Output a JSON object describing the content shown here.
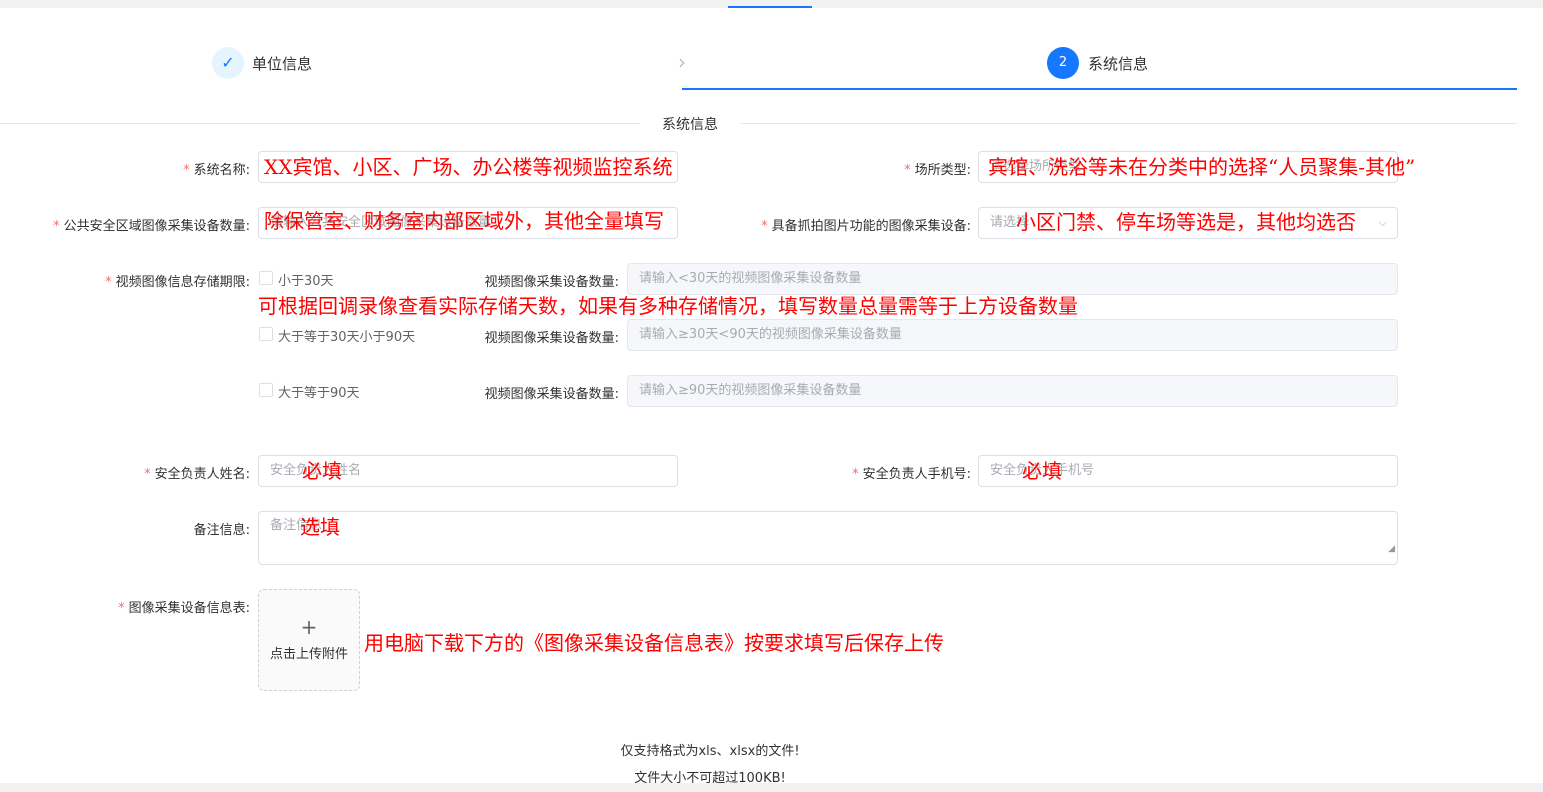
{
  "steps": {
    "step1": {
      "icon": "✓",
      "title": "单位信息"
    },
    "step2": {
      "number": "2",
      "title": "系统信息"
    }
  },
  "section_title": "系统信息",
  "fields": {
    "system_name": {
      "label": "系统名称:",
      "required": "*"
    },
    "site_type": {
      "label": "场所类型:",
      "required": "*",
      "placeholder": "请选择场所类型"
    },
    "public_devices": {
      "label": "公共安全区域图像采集设备数量:",
      "required": "*",
      "placeholder": "请输入公共安全区域图像采集设备数量"
    },
    "snapshot_devices": {
      "label": "具备抓拍图片功能的图像采集设备:",
      "required": "*",
      "placeholder": "请选择"
    },
    "storage_period": {
      "label": "视频图像信息存储期限:",
      "required": "*",
      "count_label": "视频图像采集设备数量:",
      "options": [
        {
          "text": "小于30天",
          "placeholder": "请输入<30天的视频图像采集设备数量"
        },
        {
          "text": "大于等于30天小于90天",
          "placeholder": "请输入≥30天<90天的视频图像采集设备数量"
        },
        {
          "text": "大于等于90天",
          "placeholder": "请输入≥90天的视频图像采集设备数量"
        }
      ]
    },
    "security_name": {
      "label": "安全负责人姓名:",
      "required": "*",
      "placeholder": "安全负责人姓名"
    },
    "security_phone": {
      "label": "安全负责人手机号:",
      "required": "*",
      "placeholder": "安全负责人手机号"
    },
    "remarks": {
      "label": "备注信息:",
      "placeholder": "备注信息"
    },
    "device_sheet": {
      "label": "图像采集设备信息表:",
      "required": "*",
      "upload_plus": "+",
      "upload_text": "点击上传附件"
    }
  },
  "upload_tips": [
    "仅支持格式为xls、xlsx的文件!",
    "文件大小不可超过100KB!"
  ],
  "annotations": {
    "system_name": "XX宾馆、小区、广场、办公楼等视频监控系统",
    "site_type": "宾馆、洗浴等未在分类中的选择“人员聚集-其他”",
    "public_devices": "除保管室、财务室内部区域外，其他全量填写",
    "snapshot_devices": "小区门禁、停车场等选是，其他均选否",
    "storage": "可根据回调录像查看实际存储天数，如果有多种存储情况，填写数量总量需等于上方设备数量",
    "security_name": "必填",
    "security_phone": "必填",
    "remarks": "选填",
    "upload": "用电脑下载下方的《图像采集设备信息表》按要求填写后保存上传"
  }
}
